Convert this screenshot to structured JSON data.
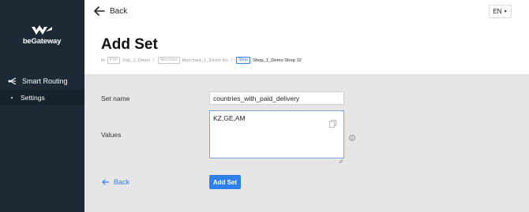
{
  "sidebar": {
    "logo_text": "beGateway",
    "nav_item_label": "Smart Routing",
    "nav_sub_label": "Settings"
  },
  "header": {
    "back_label": "Back",
    "language": "EN",
    "title": "Add Set",
    "breadcrumb": {
      "prefix": "to",
      "psp_tag": "PSP",
      "psp_name": "Psp_1_Demo",
      "merchant_tag": "Merchant",
      "merchant_name": "Merchant_1_Demo Inc",
      "shop_tag": "Shop",
      "shop_name": "Shop_1_Demo Shop 12"
    }
  },
  "form": {
    "set_name_label": "Set name",
    "set_name_value": "countries_with_paid_delivery",
    "values_label": "Values",
    "values_value": "KZ,GE,AM"
  },
  "actions": {
    "back_label": "Back",
    "add_label": "Add Set"
  },
  "colors": {
    "sidebar": "#1d2a36",
    "accent": "#2f80ed",
    "content_bg": "#e6e6e6"
  }
}
